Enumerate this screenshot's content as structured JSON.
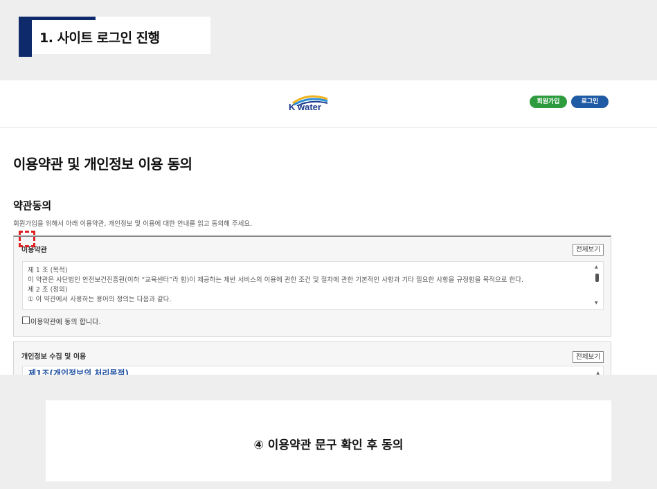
{
  "step_header": {
    "title": "1. 사이트 로그인 진행"
  },
  "site": {
    "logo_text": "K water",
    "nav": {
      "join_label": "회원가입",
      "login_label": "로그인"
    }
  },
  "page": {
    "title": "이용약관 및 개인정보 이용 동의",
    "section_title": "약관동의",
    "section_desc": "회원가입을 위해서 아래 이용약관, 개인정보 및 이용에 대한 안내를 읽고 동의해 주세요."
  },
  "terms": {
    "title": "이용약관",
    "view_all_label": "전체보기",
    "lines": [
      "제 1 조 (목적)",
      "이 약관은 사단법인 안전보건진흥원(이하 “교육센터”라 함)이 제공하는 제반 서비스의 이용에 관한 조건 및 절차에 관한 기본적인 사항과 기타 필요한 사항을 규정함을 목적으로 한다.",
      "제 2 조 (정의)",
      "① 이 약관에서 사용하는 용어의 정의는 다음과 같다."
    ],
    "agree_label": "이용약관에 동의 합니다.",
    "agree_checked": false
  },
  "privacy": {
    "title": "개인정보 수집 및 이용",
    "view_all_label": "전체보기",
    "first_heading": "제1조(개인정보의 처리목적)"
  },
  "caption": {
    "text": "④ 이용약관 문구 확인 후 동의"
  },
  "colors": {
    "header_accent": "#0e2a6b",
    "join_button": "#2e9c3e",
    "login_button": "#1f5aa5",
    "highlight": "#e02020"
  }
}
